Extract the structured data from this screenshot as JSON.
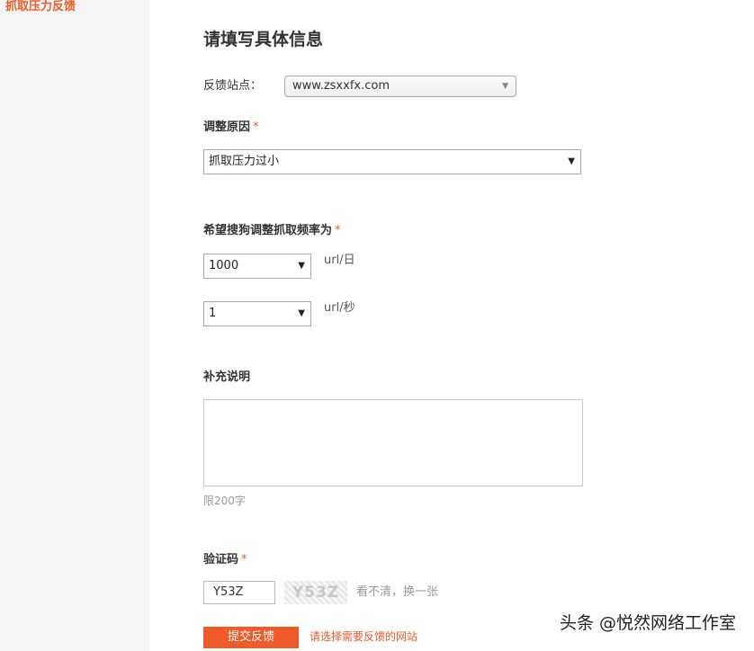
{
  "sidebar": {
    "active_item": "抓取压力反馈"
  },
  "form": {
    "title": "请填写具体信息",
    "site": {
      "label": "反馈站点：",
      "value": "www.zsxxfx.com"
    },
    "reason": {
      "label": "调整原因",
      "required_mark": "*",
      "value": "抓取压力过小"
    },
    "frequency": {
      "label": "希望搜狗调整抓取频率为",
      "required_mark": "*",
      "per_day_value": "1000",
      "per_day_unit": "url/日",
      "per_second_value": "1",
      "per_second_unit": "url/秒"
    },
    "notes": {
      "label": "补充说明",
      "value": "",
      "limit": "限200字"
    },
    "captcha": {
      "label": "验证码",
      "required_mark": "*",
      "input_value": "Y53Z",
      "image_text": "Y53Z",
      "refresh_text": "看不清，换一张"
    },
    "submit_label": "提交反馈",
    "error_hint": "请选择需要反馈的网站"
  },
  "watermark": "头条 @悦然网络工作室",
  "colors": {
    "accent": "#f05a28",
    "sidebar_bg": "#f5f5f5"
  },
  "icons": {
    "dropdown": "triangle-down"
  }
}
